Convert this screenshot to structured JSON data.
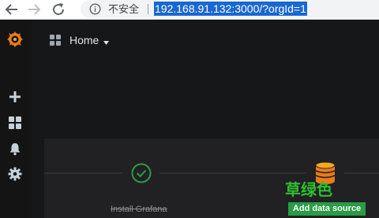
{
  "browser": {
    "security_label": "不安全",
    "url": "192.168.91.132:3000/?orgId=1",
    "icons": [
      "back-arrow-icon",
      "forward-arrow-icon",
      "reload-icon",
      "info-icon"
    ]
  },
  "sidemenu": {
    "items": [
      {
        "name": "create",
        "icon": "plus-icon"
      },
      {
        "name": "dashboards",
        "icon": "grid-icon"
      },
      {
        "name": "alerting",
        "icon": "bell-icon"
      },
      {
        "name": "configuration",
        "icon": "gear-icon"
      }
    ]
  },
  "header": {
    "dashboard_title": "Home",
    "icon": "grid-icon"
  },
  "getting_started": {
    "steps": [
      {
        "label": "Install Grafana",
        "status": "done",
        "icon": "check-circle-icon"
      },
      {
        "label": "Add data source",
        "status": "active",
        "icon": "database-icon"
      }
    ]
  },
  "watermark": "草绿色",
  "colors": {
    "accent_green": "#299c46",
    "brand_orange": "#eb7b18",
    "url_highlight": "#1967d2",
    "panel_bg": "#212124"
  }
}
